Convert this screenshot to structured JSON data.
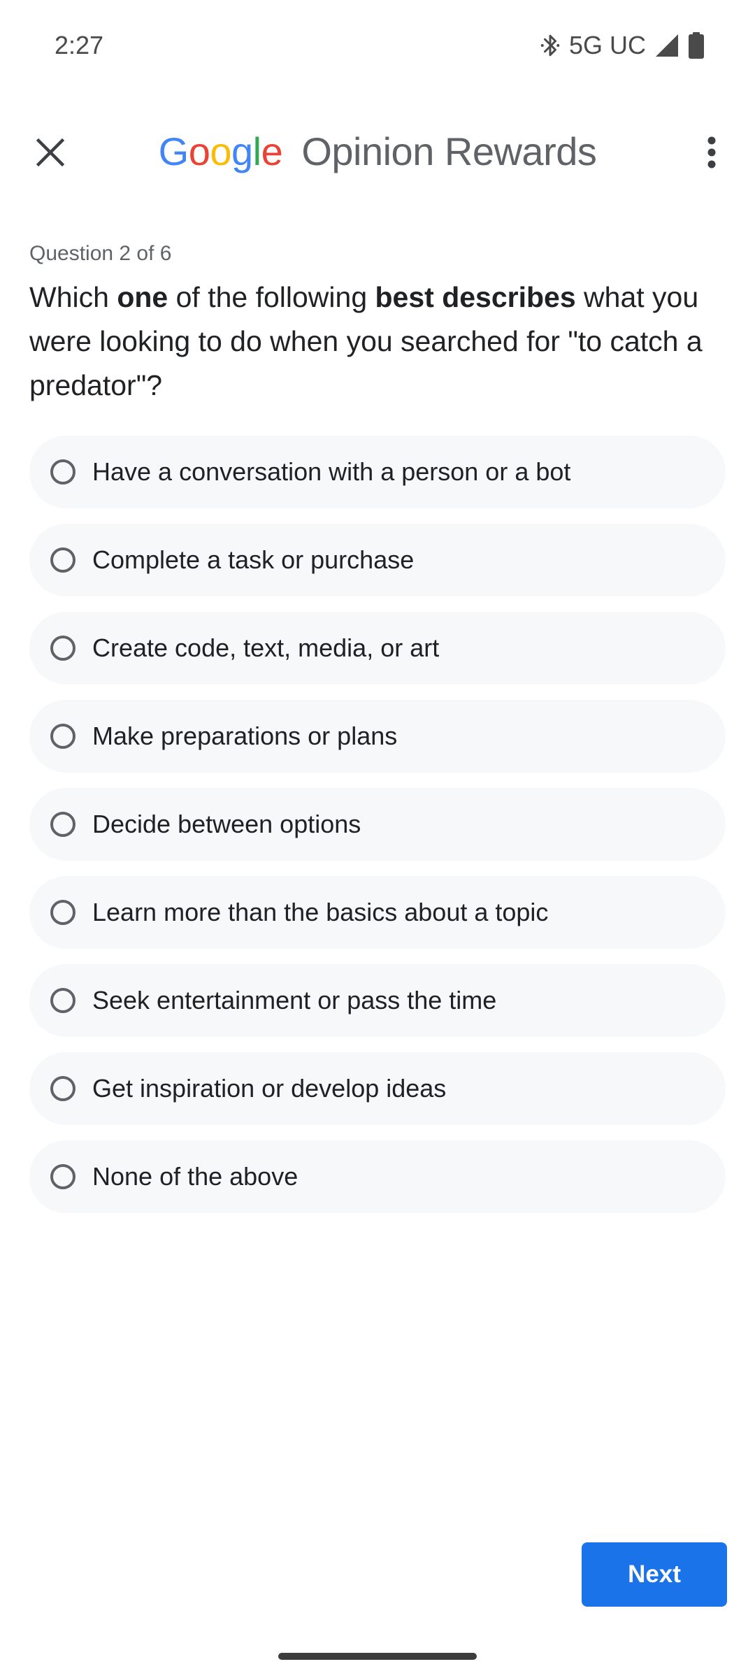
{
  "status_bar": {
    "time": "2:27",
    "network": "5G UC",
    "icons": [
      "bluetooth-icon",
      "signal-icon",
      "battery-icon"
    ]
  },
  "app_bar": {
    "close_icon": "close-icon",
    "brand": [
      "G",
      "o",
      "o",
      "g",
      "l",
      "e"
    ],
    "brand_colors": [
      "#4285F4",
      "#EA4335",
      "#FBBC05",
      "#4285F4",
      "#34A853",
      "#EA4335"
    ],
    "title_rest": "Opinion Rewards",
    "menu_icon": "more-vert-icon"
  },
  "survey": {
    "counter": "Question 2 of 6",
    "question_parts": {
      "p1": "Which ",
      "b1": "one",
      "p2": " of the following ",
      "b2": "best describes",
      "p3": " what you were looking to do when you searched for \"to catch a predator\"?"
    },
    "options": [
      {
        "label": "Have a conversation with a person or a bot",
        "selected": false
      },
      {
        "label": "Complete a task or purchase",
        "selected": false
      },
      {
        "label": "Create code, text, media, or art",
        "selected": false
      },
      {
        "label": "Make preparations or plans",
        "selected": false
      },
      {
        "label": "Decide between options",
        "selected": false
      },
      {
        "label": "Learn more than the basics about a topic",
        "selected": false
      },
      {
        "label": "Seek entertainment or pass the time",
        "selected": false
      },
      {
        "label": "Get inspiration or develop ideas",
        "selected": false
      },
      {
        "label": "None of the above",
        "selected": false
      }
    ],
    "next_label": "Next"
  },
  "colors": {
    "accent": "#1a73e8",
    "option_bg": "#f7f8fa",
    "radio": "#5f6368"
  }
}
